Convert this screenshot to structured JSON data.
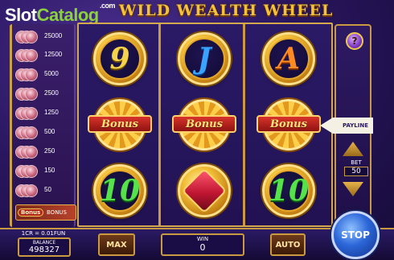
{
  "brand": {
    "slot": "Slot",
    "catalog": "Catalog",
    "com": ".com"
  },
  "game_title": "WILD WEALTH WHEEL",
  "paytable": [
    {
      "value": "25000"
    },
    {
      "value": "12500"
    },
    {
      "value": "5000"
    },
    {
      "value": "2500"
    },
    {
      "value": "1250"
    },
    {
      "value": "500"
    },
    {
      "value": "250"
    },
    {
      "value": "150"
    },
    {
      "value": "50"
    }
  ],
  "paytable_bonus": {
    "badge": "Bonus",
    "label": "BONUS"
  },
  "reels": [
    [
      "9",
      "Bonus",
      "10"
    ],
    [
      "J",
      "Bonus",
      "gem"
    ],
    [
      "A",
      "Bonus",
      "10"
    ]
  ],
  "payline_label": "PAYLINE",
  "bet": {
    "label": "BET",
    "value": "50"
  },
  "help_label": "?",
  "bottom": {
    "credit_rate": "1CR = 0.01FUN",
    "balance_label": "BALANCE",
    "balance_value": "498327",
    "max_label": "MAX",
    "win_label": "WIN",
    "win_value": "0",
    "auto_label": "AUTO",
    "stop_label": "STOP"
  }
}
